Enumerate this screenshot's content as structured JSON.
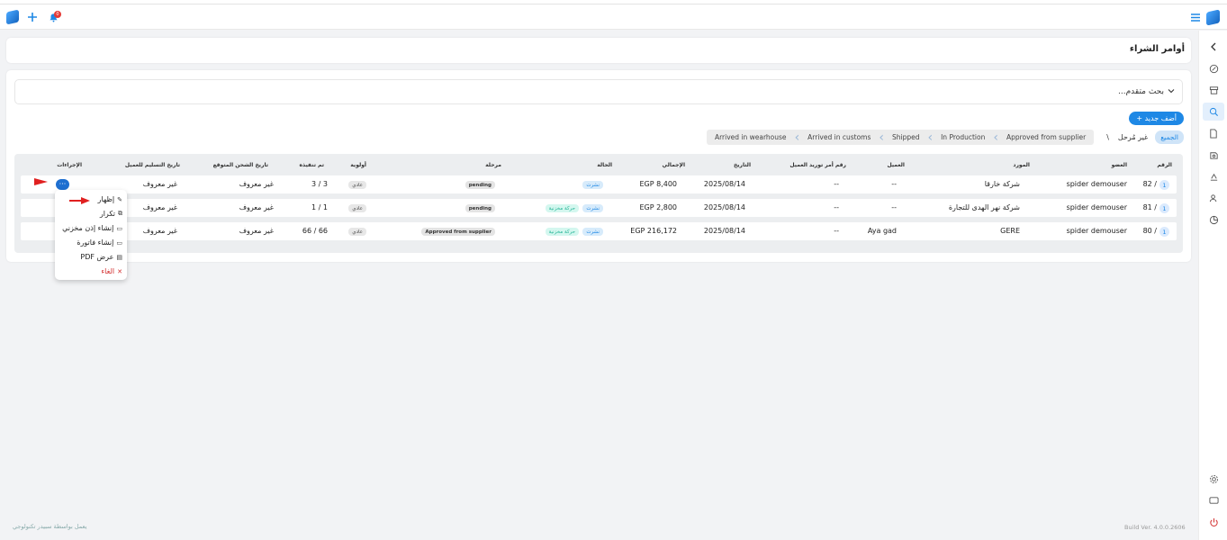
{
  "topbar": {
    "notification_count": "0"
  },
  "page": {
    "title": "أوامر الشراء"
  },
  "search": {
    "label": "بحث متقدم..."
  },
  "toolbar": {
    "add_label": "+ أضف جديد"
  },
  "filters": {
    "all": "الجميع",
    "unstaged": "غير مُرحل",
    "separator": "\\",
    "stages": [
      "Approved from supplier",
      "In Production",
      "Shipped",
      "Arrived in customs",
      "Arrived in wearhouse"
    ]
  },
  "table": {
    "headers": {
      "number": "الرقم",
      "member": "العضو",
      "supplier": "المورد",
      "customer": "العميل",
      "customer_po": "رقم أمر توريد العميل",
      "date": "التاريخ",
      "total": "الإجمالي",
      "status": "الحالة",
      "stage": "مرحلة",
      "priority": "أولوية",
      "fulfilled": "تم تنفيذه",
      "expected_ship": "تاريخ الشحن المتوقع",
      "delivery_date": "تاريخ التسليم للعميل",
      "actions": "الإجراءات"
    },
    "rows": [
      {
        "index": "1",
        "number": "82 /",
        "member": "spider demouser",
        "supplier": "شركة خارقا",
        "customer": "--",
        "customer_po": "--",
        "date": "2025/08/14",
        "total": "EGP 8,400",
        "status": "نشرت",
        "movement": "",
        "stage": "pending",
        "priority": "عادي",
        "fulfilled": "3 / 3",
        "expected_ship": "غير معروف",
        "delivery_date": "غير معروف"
      },
      {
        "index": "1",
        "number": "81 /",
        "member": "spider demouser",
        "supplier": "شركة نهر الهدى للتجارة",
        "customer": "--",
        "customer_po": "--",
        "date": "2025/08/14",
        "total": "EGP 2,800",
        "status": "نشرت",
        "movement": "حركة مخزنية",
        "stage": "pending",
        "priority": "عادي",
        "fulfilled": "1 / 1",
        "expected_ship": "غير معروف",
        "delivery_date": "غير معروف"
      },
      {
        "index": "1",
        "number": "80 /",
        "member": "spider demouser",
        "supplier": "GERE",
        "customer": "Aya gad",
        "customer_po": "--",
        "date": "2025/08/14",
        "total": "EGP 216,172",
        "status": "نشرت",
        "movement": "حركة مخزنية",
        "stage": "Approved from supplier",
        "priority": "عادي",
        "fulfilled": "66 / 66",
        "expected_ship": "غير معروف",
        "delivery_date": "غير معروف"
      }
    ],
    "actions_button": "···"
  },
  "context_menu": {
    "items": [
      {
        "label": "إظهار",
        "icon": "pencil-icon"
      },
      {
        "label": "تكرار",
        "icon": "copy-icon"
      },
      {
        "label": "إنشاء إذن مخزني",
        "icon": "inventory-icon"
      },
      {
        "label": "إنشاء فاتورة",
        "icon": "invoice-icon"
      },
      {
        "label": "عرض PDF",
        "icon": "pdf-icon"
      },
      {
        "label": "الغاء",
        "icon": "close-icon"
      }
    ]
  },
  "footer": {
    "powered_by": "يعمل بواسطة سبيدر تكنولوجي",
    "build": "Build Ver. 4.0.0.2606"
  },
  "colors": {
    "accent": "#1e88e5",
    "danger": "#d32f2f",
    "arrow": "#e02020"
  }
}
